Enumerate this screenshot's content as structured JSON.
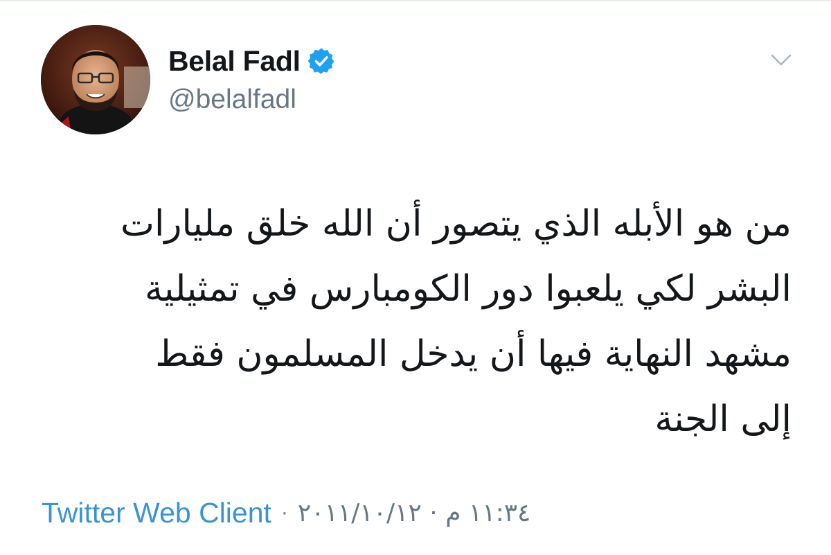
{
  "tweet": {
    "author": {
      "name": "Belal Fadl",
      "handle": "@belalfadl",
      "verified": true
    },
    "text_lines": [
      "من هو الأبله الذي يتصور أن الله خلق مليارات",
      "البشر لكي يلعبوا دور الكومبارس في تمثيلية",
      "مشهد النهاية فيها أن يدخل المسلمون فقط",
      "إلى الجنة"
    ],
    "source": "Twitter Web Client",
    "separator": "·",
    "timestamp": "١١:٣٤ م · ٢٠١١/١٠/١٢"
  },
  "icons": {
    "verified": "verified-badge-icon",
    "caret": "chevron-down-icon"
  },
  "colors": {
    "text": "#14171a",
    "secondary": "#657786",
    "link": "#3a93d4",
    "verified": "#1da1f2",
    "caret": "#aab8c2"
  }
}
